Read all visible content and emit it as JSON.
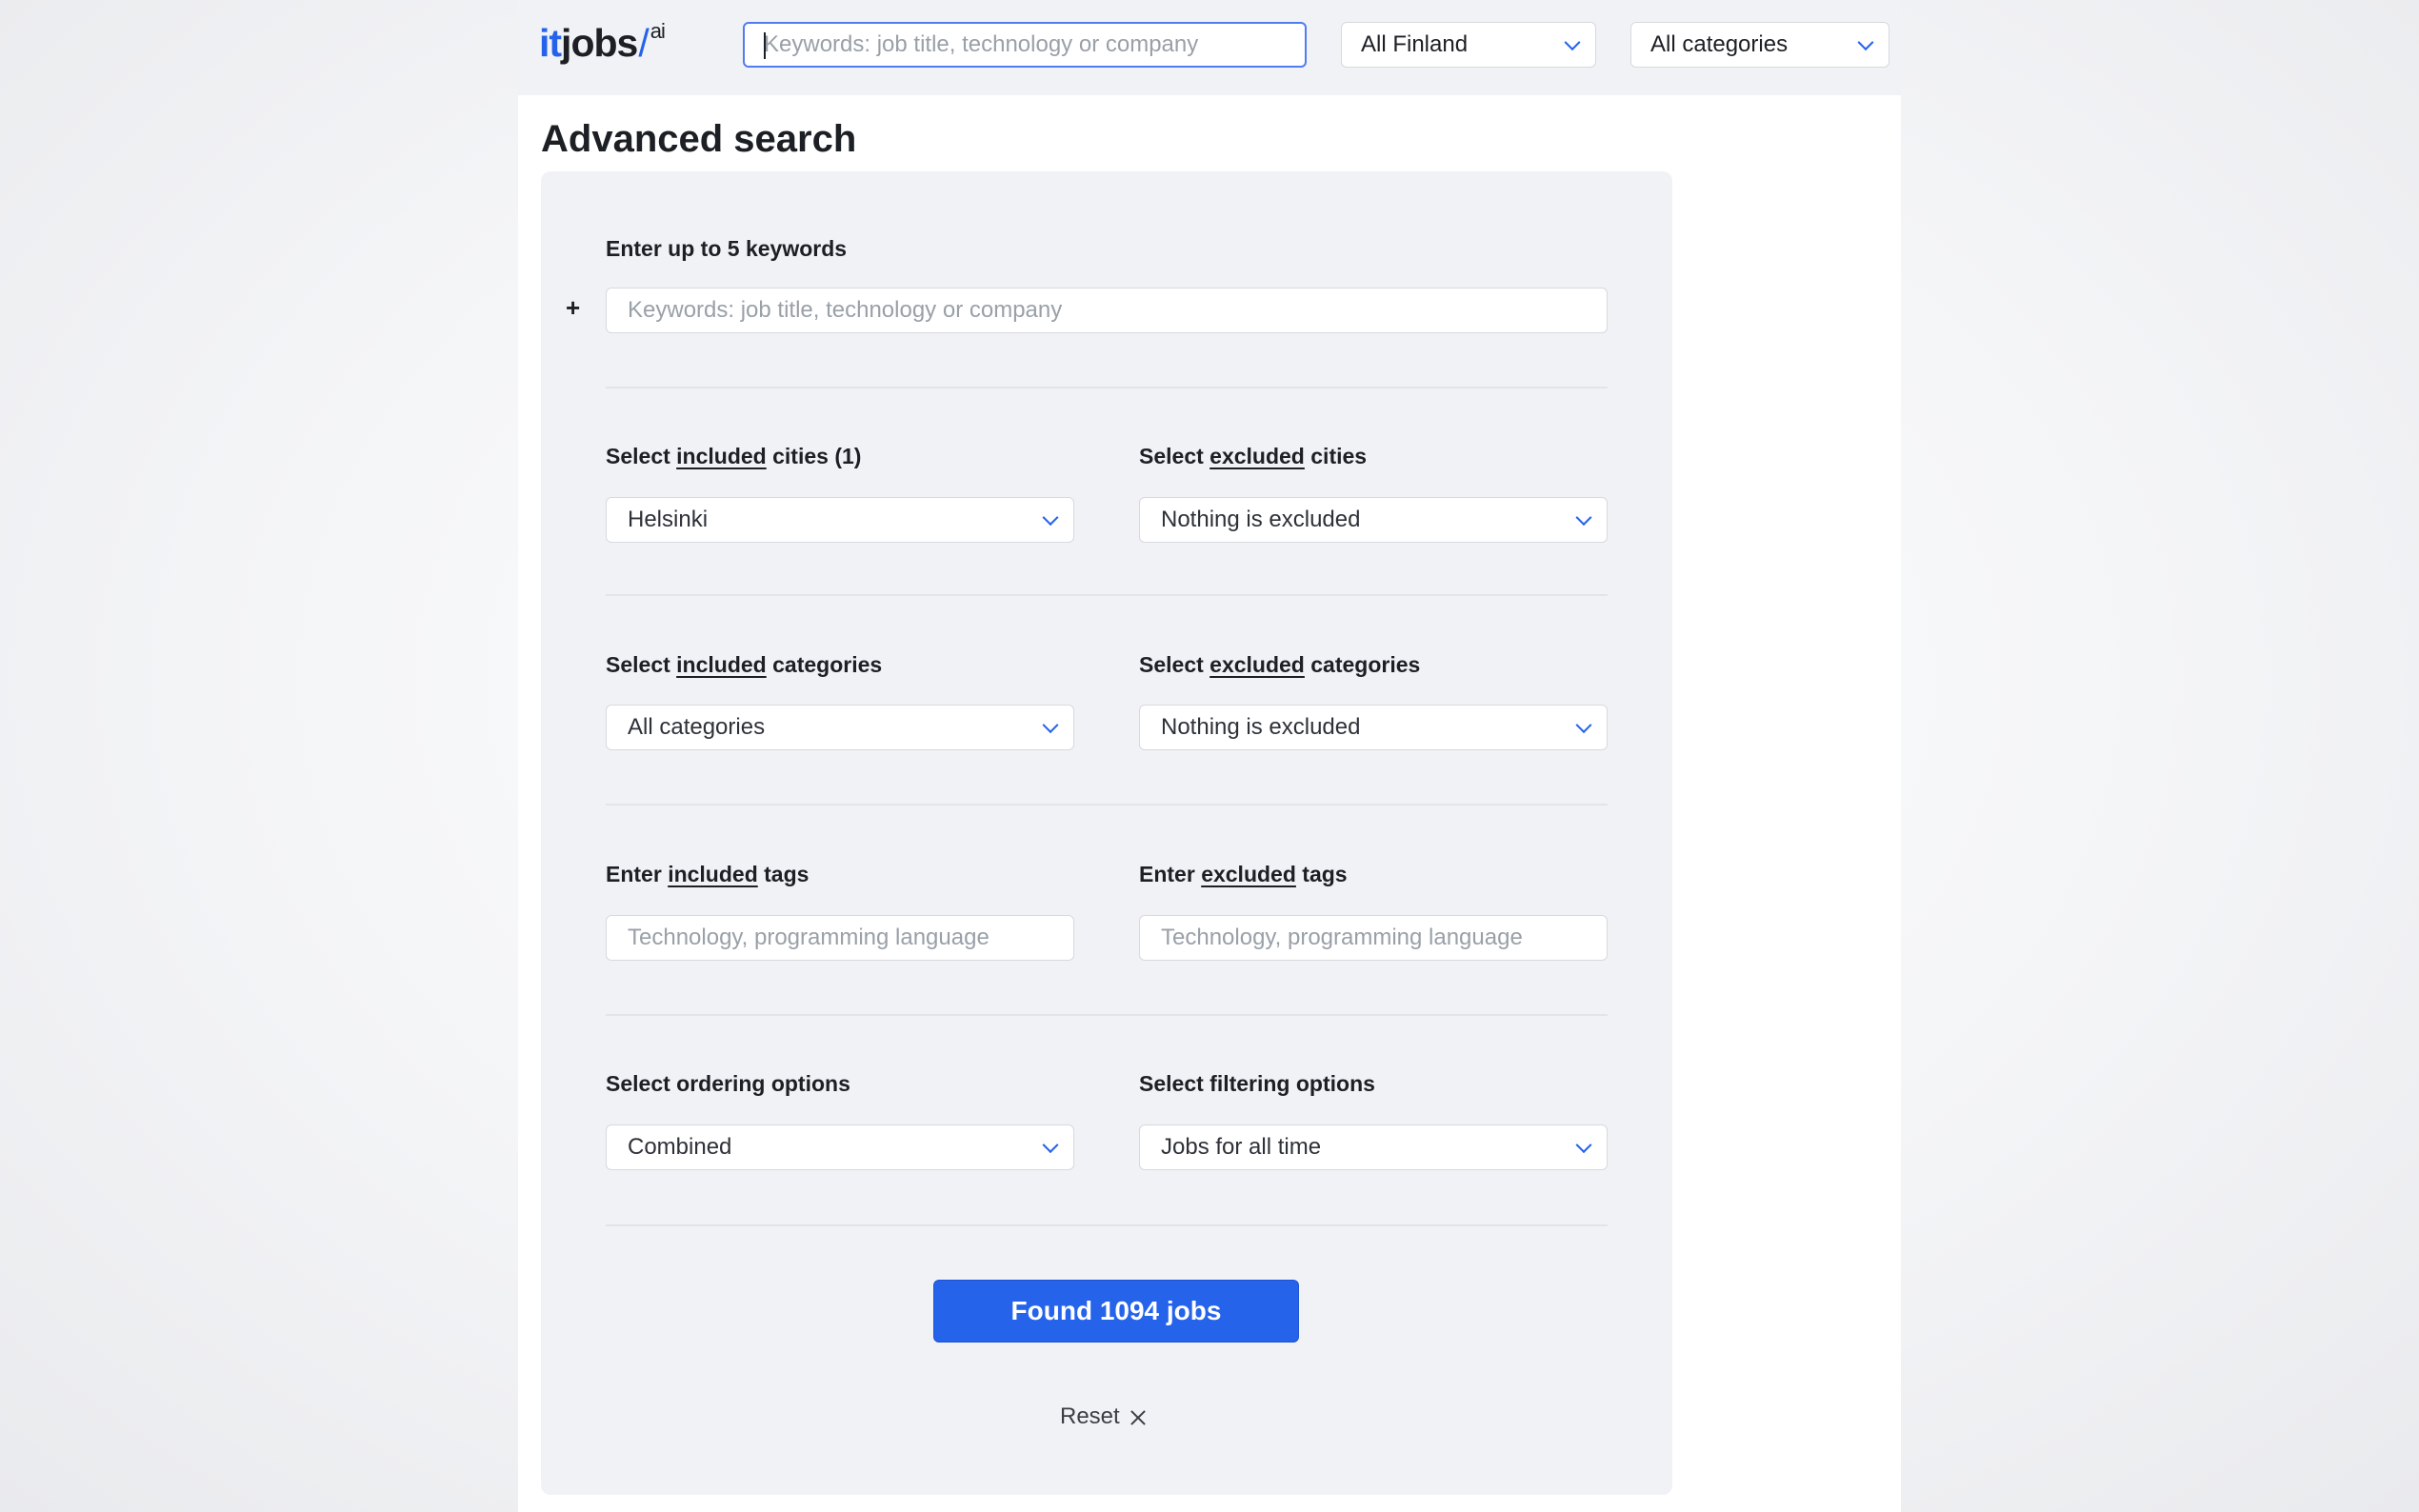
{
  "header": {
    "logo": {
      "it": "it",
      "jobs": "jobs",
      "ai": "ai"
    },
    "search_placeholder": "Keywords: job title, technology or company",
    "location_select": "All Finland",
    "category_select": "All categories"
  },
  "page_title": "Advanced search",
  "keywords": {
    "label": "Enter up to 5 keywords",
    "add_icon": "+",
    "placeholder": "Keywords: job title, technology or company"
  },
  "cities": {
    "included_label": {
      "pre": "Select ",
      "u": "included",
      "post": " cities (1)"
    },
    "included_value": "Helsinki",
    "excluded_label": {
      "pre": "Select ",
      "u": "excluded",
      "post": " cities"
    },
    "excluded_value": "Nothing is excluded"
  },
  "categories": {
    "included_label": {
      "pre": "Select ",
      "u": "included",
      "post": " categories"
    },
    "included_value": "All categories",
    "excluded_label": {
      "pre": "Select ",
      "u": "excluded",
      "post": " categories"
    },
    "excluded_value": "Nothing is excluded"
  },
  "tags": {
    "included_label": {
      "pre": "Enter ",
      "u": "included",
      "post": " tags"
    },
    "included_placeholder": "Technology, programming language",
    "excluded_label": {
      "pre": "Enter ",
      "u": "excluded",
      "post": " tags"
    },
    "excluded_placeholder": "Technology, programming language"
  },
  "options": {
    "ordering_label": "Select ordering options",
    "ordering_value": "Combined",
    "filtering_label": "Select filtering options",
    "filtering_value": "Jobs for all time"
  },
  "actions": {
    "found_button": "Found 1094 jobs",
    "reset_label": "Reset"
  },
  "colors": {
    "accent": "#2563eb",
    "panel": "#f1f2f5"
  }
}
